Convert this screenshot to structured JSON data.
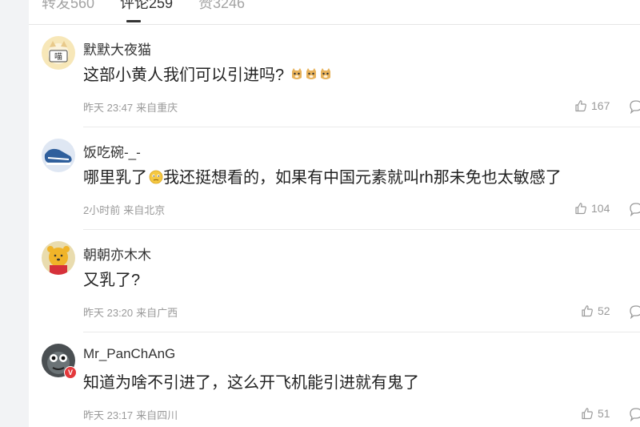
{
  "tabs": [
    {
      "label": "转发560"
    },
    {
      "label": "评论259"
    },
    {
      "label": "赞3246"
    }
  ],
  "comments": [
    {
      "username": "默默大夜猫",
      "text": "这部小黄人我们可以引进吗?",
      "emojis": [
        "doge",
        "doge",
        "doge"
      ],
      "time": "昨天 23:47",
      "location": "来自重庆",
      "likes": "167"
    },
    {
      "username": "饭吃碗-_-",
      "text_before": "哪里乳了",
      "emoji": "confused",
      "text_after": "我还挺想看的，如果有中国元素就叫rh那未免也太敏感了",
      "time": "2小时前",
      "location": "来自北京",
      "likes": "104"
    },
    {
      "username": "朝朝亦木木",
      "text": "又乳了?",
      "time": "昨天 23:20",
      "location": "来自广西",
      "likes": "52"
    },
    {
      "username": "Mr_PanChAnG",
      "text": "知道为啥不引进了，这么开飞机能引进就有鬼了",
      "time": "昨天 23:17",
      "location": "来自四川",
      "likes": "51",
      "badge": "V"
    }
  ],
  "colors": {
    "background": "#f2f3f5",
    "panel": "#ffffff",
    "text": "#222222",
    "muted": "#9a9a9a"
  }
}
